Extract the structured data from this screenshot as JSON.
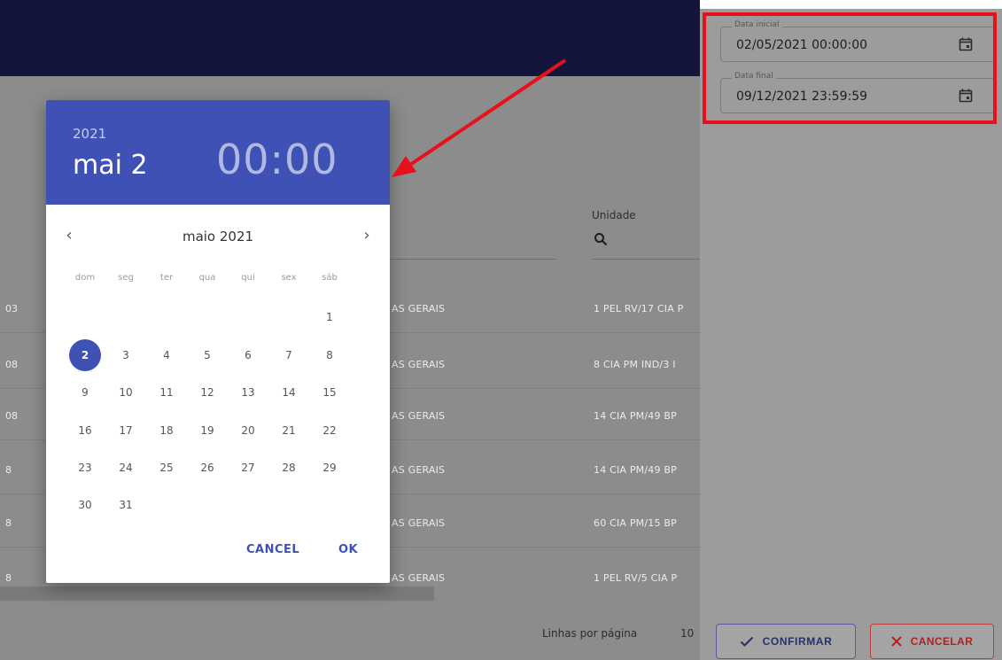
{
  "background": {
    "column_header": "Unidade",
    "left_column_fragments": [
      "03",
      "08",
      "08",
      "8",
      "8",
      "8"
    ],
    "region_cells": [
      "AS GERAIS",
      "AS GERAIS",
      "AS GERAIS",
      "AS GERAIS",
      "AS GERAIS",
      "AS GERAIS"
    ],
    "unit_cells": [
      "1 PEL RV/17 CIA P",
      "8 CIA PM IND/3 I",
      "14 CIA PM/49 BP",
      "14 CIA PM/49 BP",
      "60 CIA PM/15 BP",
      "1 PEL RV/5 CIA P"
    ],
    "rows_per_page_label": "Linhas por página",
    "rows_per_page_value": "10"
  },
  "filters": {
    "start_label": "Data inicial",
    "start_value": "02/05/2021 00:00:00",
    "end_label": "Data final",
    "end_value": "09/12/2021 23:59:59",
    "confirm_label": "CONFIRMAR",
    "cancel_label": "CANCELAR"
  },
  "picker": {
    "year": "2021",
    "date": "mai 2",
    "time": "00:00",
    "month_label": "maio 2021",
    "weekdays": [
      "dom",
      "seg",
      "ter",
      "qua",
      "qui",
      "sex",
      "sáb"
    ],
    "days": [
      "1",
      "2",
      "3",
      "4",
      "5",
      "6",
      "7",
      "8",
      "9",
      "10",
      "11",
      "12",
      "13",
      "14",
      "15",
      "16",
      "17",
      "18",
      "19",
      "20",
      "21",
      "22",
      "23",
      "24",
      "25",
      "26",
      "27",
      "28",
      "29",
      "30",
      "31"
    ],
    "first_weekday_index": 6,
    "selected_day": "2",
    "cancel_label": "CANCEL",
    "ok_label": "OK"
  },
  "colors": {
    "picker_accent": "#3f51b5",
    "app_bar": "#13163a",
    "highlight": "#e8101a"
  }
}
